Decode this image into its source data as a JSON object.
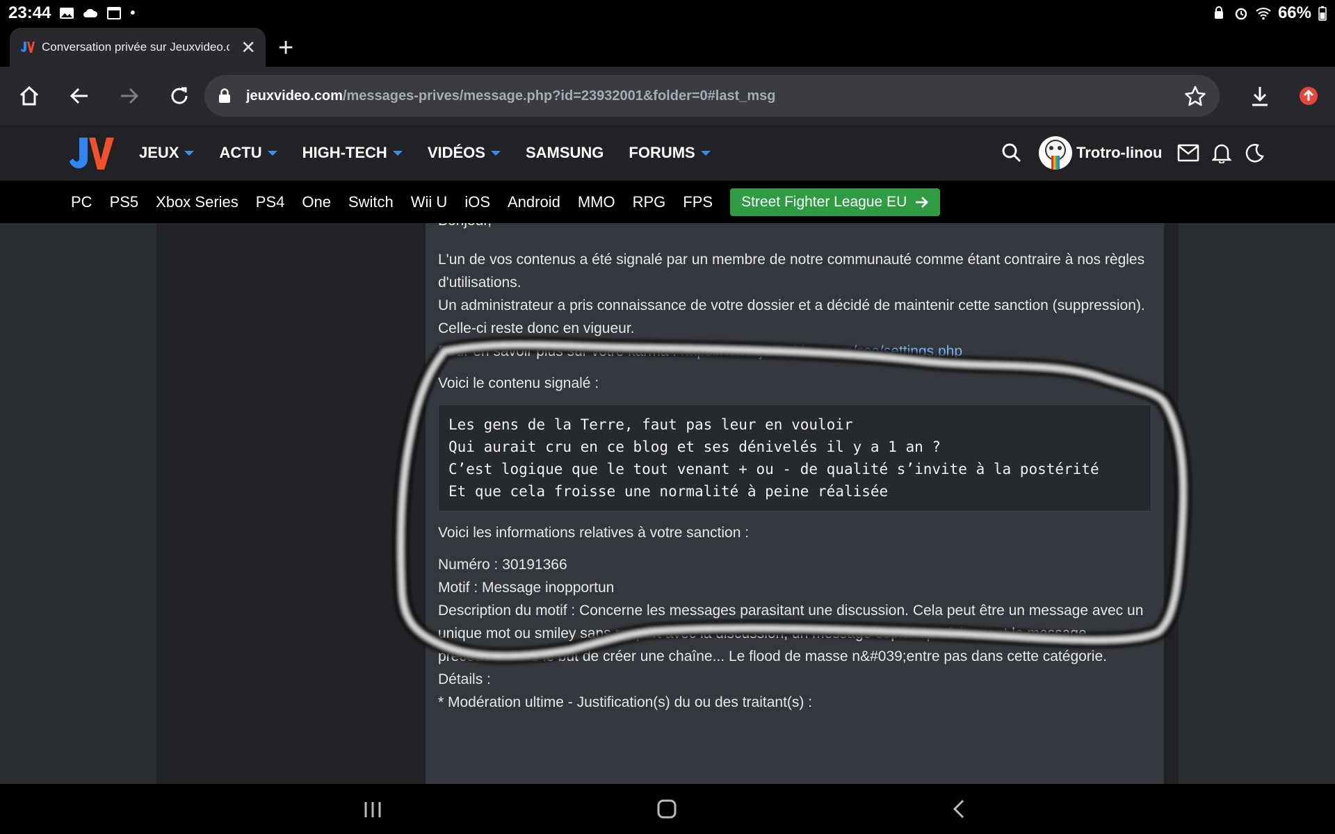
{
  "status": {
    "time": "23:44",
    "battery": "66%"
  },
  "tab": {
    "title": "Conversation privée sur Jeuxvideo.com"
  },
  "url": {
    "host": "jeuxvideo.com",
    "path": "/messages-prives/message.php?id=23932001&folder=0#last_msg"
  },
  "header": {
    "nav": [
      "JEUX",
      "ACTU",
      "HIGH-TECH",
      "VIDÉOS",
      "SAMSUNG",
      "FORUMS"
    ],
    "nav_has_caret": [
      true,
      true,
      true,
      true,
      false,
      true
    ],
    "username": "Trotro-linou"
  },
  "platforms": [
    "PC",
    "PS5",
    "Xbox Series",
    "PS4",
    "One",
    "Switch",
    "Wii U",
    "iOS",
    "Android",
    "MMO",
    "RPG",
    "FPS"
  ],
  "promo": {
    "label": "Street Fighter League EU"
  },
  "message": {
    "greeting": "Bonjour,",
    "p1": "L'un de vos contenus a été signalé par un membre de notre communauté comme étant contraire à nos règles d'utilisations.",
    "p2": "Un administrateur a pris connaissance de votre dossier et a décidé de maintenir cette sanction (suppression). Celle-ci reste donc en vigueur.",
    "karma_prefix": "Pour en savoir plus sur votre karma :",
    "karma_link": "https://www.jeuxvideo.com/sso/settings.php",
    "reported_intro": "Voici le contenu signalé :",
    "quote_lines": [
      "Les gens de la Terre, faut pas leur en vouloir",
      "Qui aurait cru en ce blog et ses dénivelés il y a 1 an ?",
      "C’est logique que le tout venant + ou - de qualité s’invite à la postérité",
      "Et que cela froisse une normalité à peine réalisée"
    ],
    "sanction_intro": "Voici les informations relatives à votre sanction :",
    "numero": "Numéro : 30191366",
    "motif": "Motif : Message inopportun",
    "description": "Description du motif : Concerne les messages parasitant une discussion. Cela peut être un message avec un unique mot ou smiley sans rapport avec la discussion, un message copiant parfaitement le message précédent dans le but de créer une chaîne... Le flood de masse n&#039;entre pas dans cette catégorie.",
    "details": "Détails :",
    "moderation": "* Modération ultime - Justification(s) du ou des traitant(s) :"
  }
}
